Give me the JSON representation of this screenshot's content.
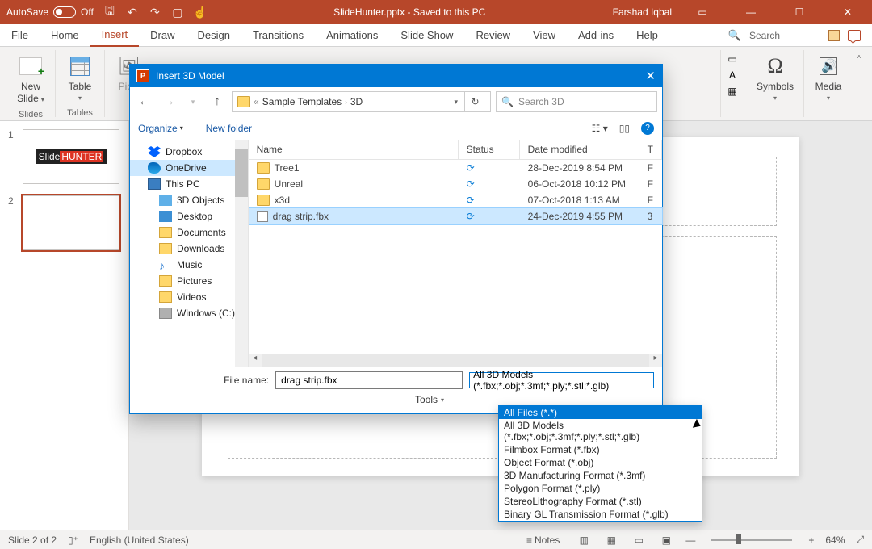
{
  "titlebar": {
    "autosave": "AutoSave",
    "off": "Off",
    "filename": "SlideHunter.pptx  -  Saved to this PC",
    "user": "Farshad Iqbal"
  },
  "tabs": {
    "file": "File",
    "home": "Home",
    "insert": "Insert",
    "draw": "Draw",
    "design": "Design",
    "transitions": "Transitions",
    "animations": "Animations",
    "slideshow": "Slide Show",
    "review": "Review",
    "view": "View",
    "addins": "Add-ins",
    "help": "Help",
    "search": "Search"
  },
  "ribbon": {
    "newslide": "New\nSlide",
    "g_slides": "Slides",
    "table": "Table",
    "g_tables": "Tables",
    "pictures": "Pictu",
    "symbols": "Symbols",
    "media": "Media"
  },
  "thumbs": {
    "one": "1",
    "two": "2",
    "badge_a": "Slide",
    "badge_b": "HUNTER"
  },
  "status": {
    "slide": "Slide 2 of 2",
    "lang": "English (United States)",
    "notes": "Notes",
    "zoom": "64%"
  },
  "dialog": {
    "title": "Insert 3D Model",
    "crumb_a": "Sample Templates",
    "crumb_b": "3D",
    "search_ph": "Search 3D",
    "organize": "Organize",
    "newfolder": "New folder",
    "tree": {
      "dropbox": "Dropbox",
      "onedrive": "OneDrive",
      "thispc": "This PC",
      "obj3d": "3D Objects",
      "desktop": "Desktop",
      "documents": "Documents",
      "downloads": "Downloads",
      "music": "Music",
      "pictures": "Pictures",
      "videos": "Videos",
      "windows": "Windows (C:)"
    },
    "cols": {
      "name": "Name",
      "status": "Status",
      "date": "Date modified",
      "t": "T"
    },
    "rows": [
      {
        "name": "Tree1",
        "date": "28-Dec-2019 8:54 PM",
        "t": "F",
        "type": "folder"
      },
      {
        "name": "Unreal",
        "date": "06-Oct-2018 10:12 PM",
        "t": "F",
        "type": "folder"
      },
      {
        "name": "x3d",
        "date": "07-Oct-2018 1:13 AM",
        "t": "F",
        "type": "folder"
      },
      {
        "name": "drag strip.fbx",
        "date": "24-Dec-2019 4:55 PM",
        "t": "3",
        "type": "file"
      }
    ],
    "filename_lbl": "File name:",
    "filename": "drag strip.fbx",
    "filetype": "All 3D Models (*.fbx;*.obj;*.3mf;*.ply;*.stl;*.glb)",
    "tools": "Tools"
  },
  "dropdown": {
    "items": [
      "All Files (*.*)",
      "All 3D Models (*.fbx;*.obj;*.3mf;*.ply;*.stl;*.glb)",
      "Filmbox Format (*.fbx)",
      "Object Format (*.obj)",
      "3D Manufacturing Format (*.3mf)",
      "Polygon Format (*.ply)",
      "StereoLithography Format (*.stl)",
      "Binary GL Transmission Format (*.glb)"
    ]
  },
  "chart_data": null
}
